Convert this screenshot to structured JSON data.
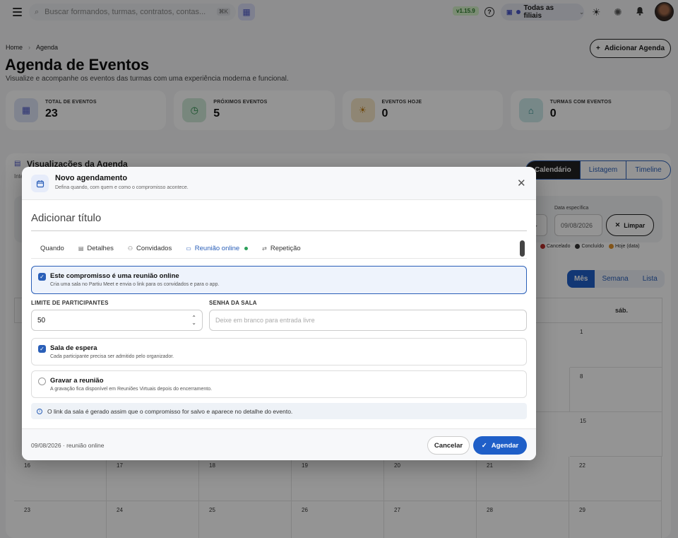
{
  "topbar": {
    "search_placeholder": "Buscar formandos, turmas, contratos, contas...",
    "search_kbd": "⌘K",
    "version": "v1.15.9",
    "filial": "Todas as filiais"
  },
  "breadcrumb": {
    "home": "Home",
    "current": "Agenda"
  },
  "header": {
    "title": "Agenda de Eventos",
    "subtitle": "Visualize e acompanhe os eventos das turmas com uma experiência moderna e funcional.",
    "add_button": "Adicionar Agenda"
  },
  "stats": [
    {
      "label": "Total de eventos",
      "value": "23",
      "icon": "calendar-icon",
      "color": "#dde3f7"
    },
    {
      "label": "Próximos eventos",
      "value": "5",
      "icon": "clock-icon",
      "color": "#cfe9d8"
    },
    {
      "label": "Eventos hoje",
      "value": "0",
      "icon": "sun-icon",
      "color": "#f7e7c8"
    },
    {
      "label": "Turmas com eventos",
      "value": "0",
      "icon": "graduation-icon",
      "color": "#cdeaea"
    }
  ],
  "viz": {
    "title": "Visualizações da Agenda",
    "subtitle": "Inte",
    "view_tabs": [
      "Calendário",
      "Listagem",
      "Timeline"
    ],
    "date_label": "Data específica",
    "date_value": "09/08/2026",
    "clear_button": "Limpar",
    "legend": [
      {
        "label": "Cancelado",
        "color": "#c0302c"
      },
      {
        "label": "Concluído",
        "color": "#333333"
      },
      {
        "label": "Hoje (data)",
        "color": "#e0922a"
      }
    ],
    "mode_tabs": [
      "Mês",
      "Semana",
      "Lista"
    ],
    "weekday_last": "sáb."
  },
  "calendar": {
    "days": [
      "1",
      "8",
      "15",
      "16",
      "17",
      "18",
      "19",
      "20",
      "21",
      "22",
      "23",
      "24",
      "25",
      "26",
      "27",
      "28",
      "29"
    ]
  },
  "modal": {
    "title": "Novo agendamento",
    "subtitle": "Defina quando, com quem e como o compromisso acontece.",
    "title_placeholder": "Adicionar título",
    "tabs": [
      {
        "label": "Quando",
        "icon": ""
      },
      {
        "label": "Detalhes",
        "icon": "doc-icon"
      },
      {
        "label": "Convidados",
        "icon": "users-icon"
      },
      {
        "label": "Reunião online",
        "icon": "video-icon"
      },
      {
        "label": "Repetição",
        "icon": "repeat-icon"
      }
    ],
    "online_option": {
      "title": "Este compromisso é uma reunião online",
      "subtitle": "Cria uma sala no Partiu Meet e envia o link para os convidados e para o app."
    },
    "limit_label": "Limite de participantes",
    "limit_value": "50",
    "password_label": "Senha da sala",
    "password_placeholder": "Deixe em branco para entrada livre",
    "waiting_room": {
      "title": "Sala de espera",
      "subtitle": "Cada participante precisa ser admitido pelo organizador."
    },
    "record": {
      "title": "Gravar a reunião",
      "subtitle": "A gravação fica disponível em Reuniões Virtuais depois do encerramento."
    },
    "info": "O link da sala é gerado assim que o compromisso for salvo e aparece no detalhe do evento.",
    "footer_note": "09/08/2026 · reunião online",
    "cancel": "Cancelar",
    "submit": "Agendar"
  }
}
